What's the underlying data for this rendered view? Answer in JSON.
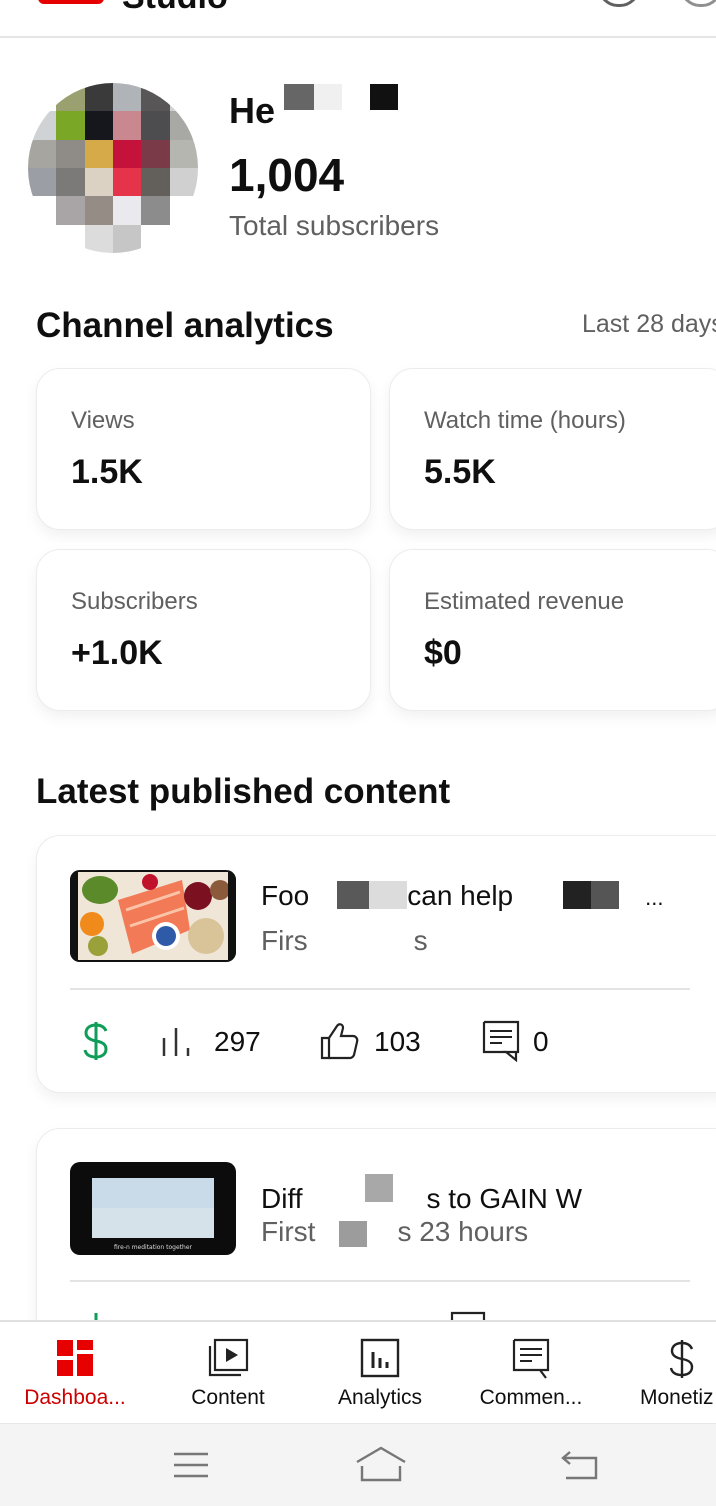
{
  "header": {
    "app_title": "Studio"
  },
  "channel": {
    "name_visible": "He",
    "subscriber_count": "1,004",
    "subscriber_label": "Total subscribers"
  },
  "analytics": {
    "title": "Channel analytics",
    "range": "Last 28 days",
    "metrics": [
      {
        "label": "Views",
        "value": "1.5K"
      },
      {
        "label": "Watch time (hours)",
        "value": "5.5K"
      },
      {
        "label": "Subscribers",
        "value": "+1.0K"
      },
      {
        "label": "Estimated revenue",
        "value": "$0"
      }
    ]
  },
  "content": {
    "title": "Latest published content",
    "items": [
      {
        "title_parts": [
          "Foo",
          "can help",
          "..."
        ],
        "subtitle_parts": [
          "Firs",
          "s"
        ],
        "views": "297",
        "likes": "103",
        "comments": "0",
        "thumb_caption": ""
      },
      {
        "title_parts": [
          "Diff",
          "s to GAIN W"
        ],
        "subtitle_parts": [
          "First",
          "s 23 hours"
        ],
        "views": "",
        "likes": "",
        "comments": "",
        "thumb_caption": "fire-n meditation together"
      }
    ]
  },
  "nav": {
    "items": [
      {
        "label": "Dashboa...",
        "icon": "dashboard-icon",
        "active": true
      },
      {
        "label": "Content",
        "icon": "content-icon",
        "active": false
      },
      {
        "label": "Analytics",
        "icon": "analytics-icon",
        "active": false
      },
      {
        "label": "Commen...",
        "icon": "comments-icon",
        "active": false
      },
      {
        "label": "Monetiz",
        "icon": "monetization-icon",
        "active": false
      }
    ]
  },
  "colors": {
    "accent": "#cc0000",
    "money_green": "#0f9d58",
    "text_secondary": "#606060"
  }
}
